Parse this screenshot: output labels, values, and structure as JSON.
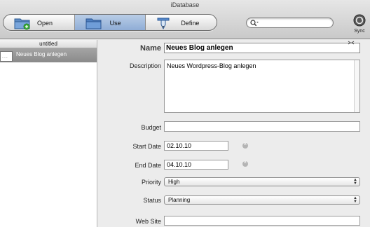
{
  "window": {
    "title": "iDatabase"
  },
  "toolbar": {
    "open_label": "Open",
    "use_label": "Use",
    "define_label": "Define",
    "search_placeholder": "",
    "sync_label": "Sync"
  },
  "sidebar": {
    "header": "untitled",
    "rows": [
      {
        "thumb_text": "...",
        "label": "Neues Blog anlegen"
      }
    ]
  },
  "form": {
    "name_label": "Name",
    "name_value": "Neues Blog anlegen",
    "description_label": "Description",
    "description_value": "Neues Wordpress-Blog anlegen",
    "budget_label": "Budget",
    "budget_value": "",
    "start_date_label": "Start Date",
    "start_date_value": "02.10.10",
    "end_date_label": "End Date",
    "end_date_value": "04.10.10",
    "priority_label": "Priority",
    "priority_value": "High",
    "status_label": "Status",
    "status_value": "Planning",
    "website_label": "Web Site",
    "website_value": ""
  },
  "colors": {
    "active_segment": "#9fb8dc",
    "selected_row": "#989898"
  }
}
